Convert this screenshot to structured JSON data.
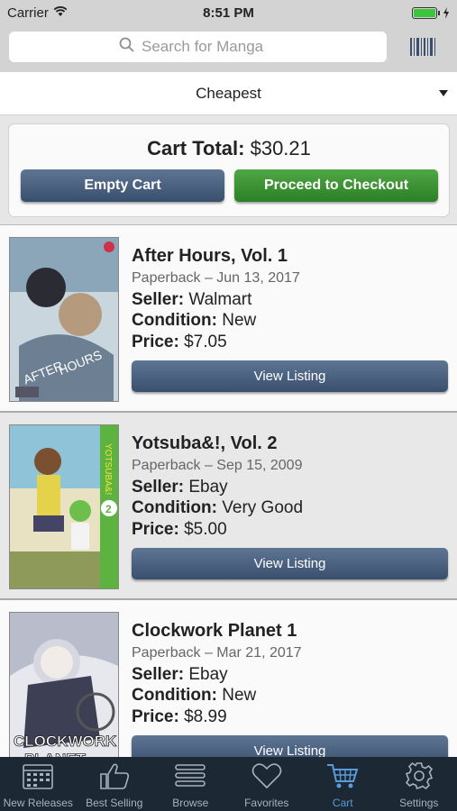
{
  "status_bar": {
    "carrier": "Carrier",
    "time": "8:51 PM"
  },
  "search": {
    "placeholder": "Search for Manga",
    "value": ""
  },
  "sort": {
    "selected": "Cheapest"
  },
  "cart": {
    "total_label": "Cart Total:",
    "total_value": "$30.21",
    "empty_label": "Empty Cart",
    "checkout_label": "Proceed to Checkout"
  },
  "labels": {
    "seller": "Seller:",
    "condition": "Condition:",
    "price": "Price:"
  },
  "listings": [
    {
      "title": "After Hours, Vol. 1",
      "format": "Paperback – Jun 13, 2017",
      "seller": "Walmart",
      "condition": "New",
      "price": "$7.05",
      "button": "View Listing",
      "cover_text": "AFTER HOURS"
    },
    {
      "title": "Yotsuba&!, Vol. 2",
      "format": "Paperback – Sep 15, 2009",
      "seller": "Ebay",
      "condition": "Very Good",
      "price": "$5.00",
      "button": "View Listing",
      "cover_text": "YOTSUBA&!"
    },
    {
      "title": "Clockwork Planet 1",
      "format": "Paperback – Mar 21, 2017",
      "seller": "Ebay",
      "condition": "New",
      "price": "$8.99",
      "button": "View Listing",
      "cover_text": "CLOCKWORK PLANET"
    }
  ],
  "tabs": [
    {
      "label": "New Releases",
      "icon": "calendar-icon"
    },
    {
      "label": "Best Selling",
      "icon": "thumbs-up-icon"
    },
    {
      "label": "Browse",
      "icon": "menu-icon"
    },
    {
      "label": "Favorites",
      "icon": "heart-icon"
    },
    {
      "label": "Cart",
      "icon": "cart-icon",
      "active": true
    },
    {
      "label": "Settings",
      "icon": "gear-icon"
    }
  ],
  "colors": {
    "accent": "#5b9bd9",
    "checkout": "#2c7f25",
    "button": "#3a4f6e",
    "tabbar": "#1c2833"
  }
}
